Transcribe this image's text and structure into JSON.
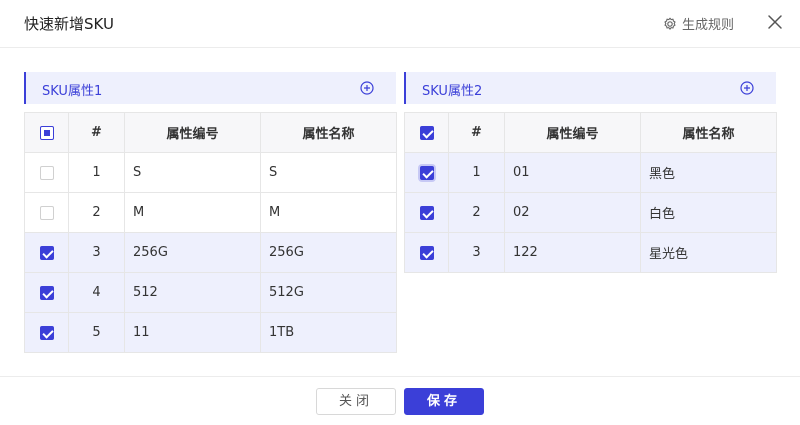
{
  "dialog": {
    "title": "快速新增SKU",
    "gen_rules_label": "生成规则"
  },
  "left_panel": {
    "title": "SKU属性1",
    "headers": [
      "#",
      "属性编号",
      "属性名称"
    ],
    "header_checkbox": "indeterminate",
    "rows": [
      {
        "index": "1",
        "code": "S",
        "name": "S",
        "checked": false
      },
      {
        "index": "2",
        "code": "M",
        "name": "M",
        "checked": false
      },
      {
        "index": "3",
        "code": "256G",
        "name": "256G",
        "checked": true
      },
      {
        "index": "4",
        "code": "512",
        "name": "512G",
        "checked": true
      },
      {
        "index": "5",
        "code": "11",
        "name": "1TB",
        "checked": true
      }
    ]
  },
  "right_panel": {
    "title": "SKU属性2",
    "headers": [
      "#",
      "属性编号",
      "属性名称"
    ],
    "header_checkbox": "checked",
    "rows": [
      {
        "index": "1",
        "code": "01",
        "name": "黑色",
        "checked": true
      },
      {
        "index": "2",
        "code": "02",
        "name": "白色",
        "checked": true
      },
      {
        "index": "3",
        "code": "122",
        "name": "星光色",
        "checked": true
      }
    ]
  },
  "footer": {
    "close_label": "关闭",
    "save_label": "保存"
  },
  "colors": {
    "accent": "#3b3fd8",
    "selected_row_bg": "#eef0fd"
  },
  "icons": {
    "gen_rules": "gear-icon",
    "close": "close-icon",
    "add": "add-circle-icon"
  }
}
